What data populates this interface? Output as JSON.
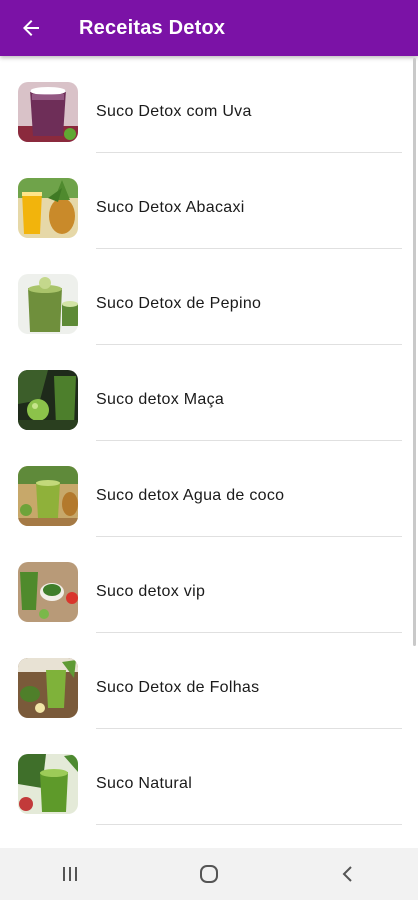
{
  "app_bar": {
    "title": "Receitas Detox",
    "background": "#7b12a6",
    "back_icon": "arrow-left-icon"
  },
  "recipes": [
    {
      "label": "Suco Detox com Uva",
      "icon": "purple-grape-juice-glass-photo"
    },
    {
      "label": "Suco Detox Abacaxi",
      "icon": "pineapple-orange-juice-photo"
    },
    {
      "label": "Suco Detox de Pepino",
      "icon": "cucumber-green-juice-photo"
    },
    {
      "label": "Suco detox Maça",
      "icon": "apple-green-juice-photo"
    },
    {
      "label": "Suco detox Agua de coco",
      "icon": "coconut-water-green-juice-photo"
    },
    {
      "label": "Suco detox vip",
      "icon": "green-juice-with-spinach-bowl-photo"
    },
    {
      "label": "Suco Detox de Folhas",
      "icon": "leafy-green-juice-photo"
    },
    {
      "label": "Suco Natural",
      "icon": "kale-green-juice-photo"
    }
  ],
  "system_nav": {
    "recents_icon": "recent-apps-icon",
    "home_icon": "home-circle-icon",
    "back_icon": "chevron-back-icon"
  }
}
